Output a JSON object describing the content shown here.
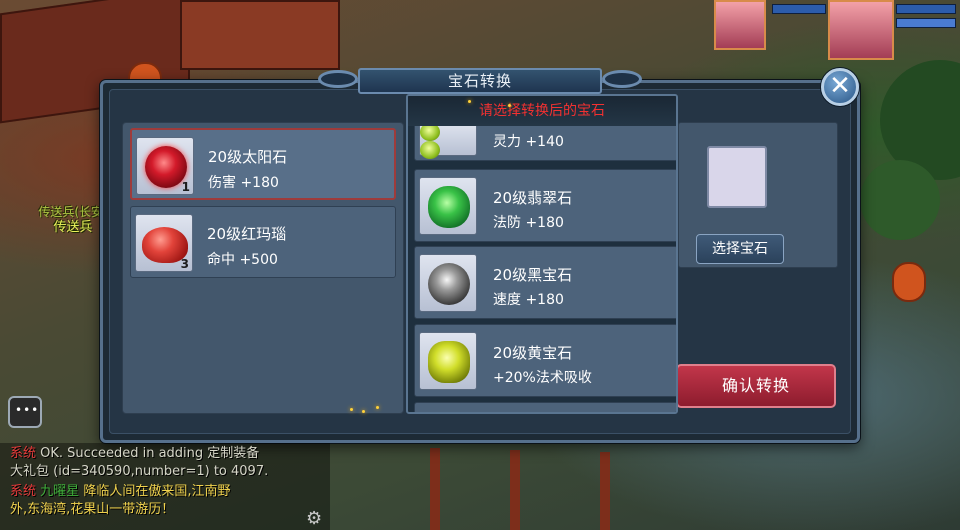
{
  "dialog": {
    "title": "宝石转换",
    "close_symbol": "✕"
  },
  "owned_gems": [
    {
      "name": "20级太阳石",
      "stat": "伤害 +180",
      "qty": "1",
      "icon": "sun-stone-icon",
      "selected": true
    },
    {
      "name": "20级红玛瑙",
      "stat": "命中 +500",
      "qty": "3",
      "icon": "red-agate-icon",
      "selected": false
    }
  ],
  "dropdown": {
    "title": "请选择转换后的宝石",
    "items": [
      {
        "name": "",
        "stat": "灵力 +140",
        "icon": "green-gem-icon"
      },
      {
        "name": "20级翡翠石",
        "stat": "法防 +180",
        "icon": "emerald-icon"
      },
      {
        "name": "20级黑宝石",
        "stat": "速度 +180",
        "icon": "black-gem-icon"
      },
      {
        "name": "20级黄宝石",
        "stat": "+20%法术吸收",
        "icon": "yellow-gem-icon"
      }
    ]
  },
  "actions": {
    "select_gem": "选择宝石",
    "confirm": "确认转换"
  },
  "npc": {
    "label": "传送兵",
    "label_shadow": "传送兵(长安)"
  },
  "chat": {
    "lines": [
      {
        "tag": "系统",
        "text": "OK. Succeeded in adding 定制装备",
        "cont": ""
      },
      {
        "tag": "",
        "text": "大礼包 (id=340590,number=1) to 4097.",
        "cont": ""
      },
      {
        "tag": "系统",
        "name": "九曜星",
        "text": "降临人间在傲来国,江南野",
        "cont": ""
      },
      {
        "tag": "",
        "text": "外,东海湾,花果山一带游历！",
        "cont": ""
      }
    ]
  },
  "colors": {
    "accent_red": "#f23131",
    "selected_border": "#9e3b3b",
    "confirm_button": "#c2364a"
  }
}
